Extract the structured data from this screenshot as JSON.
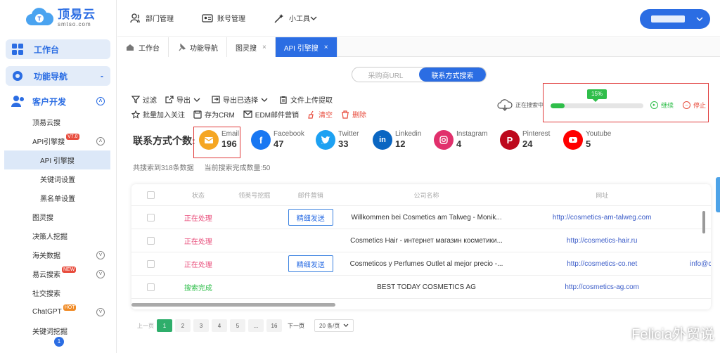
{
  "logo": {
    "title": "顶易云",
    "sub": "smtso.com"
  },
  "sidebar": {
    "workbench": "工作台",
    "function_nav": "功能导航",
    "function_nav_toggle": "-",
    "customer_dev": "客户开发",
    "items": [
      {
        "label": "顶易云搜",
        "badge": ""
      },
      {
        "label": "API引擎搜",
        "badge": "V7.0"
      },
      {
        "label": "API 引擎搜",
        "badge": ""
      },
      {
        "label": "关键词设置",
        "badge": ""
      },
      {
        "label": "黑名单设置",
        "badge": ""
      },
      {
        "label": "图灵搜",
        "badge": ""
      },
      {
        "label": "决策人挖掘",
        "badge": ""
      },
      {
        "label": "海关数据",
        "badge": ""
      },
      {
        "label": "易云搜索",
        "badge": "NEW"
      },
      {
        "label": "社交搜索",
        "badge": ""
      },
      {
        "label": "ChatGPT",
        "badge": "HOT"
      },
      {
        "label": "关键词挖掘",
        "badge": ""
      }
    ],
    "scroll_marker": "1"
  },
  "topbar": {
    "dept": "部门管理",
    "account": "账号管理",
    "tools": "小工具"
  },
  "tabs": [
    {
      "label": "工作台",
      "closable": false
    },
    {
      "label": "功能导航",
      "closable": false
    },
    {
      "label": "图灵搜",
      "closable": true
    },
    {
      "label": "API 引擎搜",
      "closable": true,
      "active": true
    }
  ],
  "toggle": {
    "left": "采购商URL",
    "right": "联系方式搜索"
  },
  "toolbar": {
    "row1": [
      "过滤",
      "导出",
      "导出已选择",
      "文件上传提取"
    ],
    "row2": [
      "批量加入关注",
      "存为CRM",
      "EDM邮件营销",
      "清空",
      "删除"
    ]
  },
  "progress": {
    "status": "正在搜索中",
    "percent_label": "15%",
    "percent": 15,
    "resume": "继续",
    "stop": "停止"
  },
  "contacts": {
    "label": "联系方式个数:",
    "channels": [
      {
        "name": "Email",
        "value": "196",
        "color": "#f5a623"
      },
      {
        "name": "Facebook",
        "value": "47",
        "color": "#1877f2"
      },
      {
        "name": "Twitter",
        "value": "33",
        "color": "#1da1f2"
      },
      {
        "name": "Linkedin",
        "value": "12",
        "color": "#0a66c2"
      },
      {
        "name": "Instagram",
        "value": "4",
        "color": "#e1306c"
      },
      {
        "name": "Pinterest",
        "value": "24",
        "color": "#bd081c"
      },
      {
        "name": "Youtube",
        "value": "5",
        "color": "#ff0000"
      }
    ]
  },
  "summary": {
    "total": "共搜索到318条数据",
    "done": "当前搜索完成数量:50"
  },
  "table": {
    "headers": [
      "状态",
      "领英号挖掘",
      "邮件营销",
      "公司名称",
      "网址"
    ],
    "send_label": "精细发送",
    "rows": [
      {
        "status": "正在处理",
        "state": "proc",
        "send": true,
        "company": "Willkommen bei Cosmetics am Talweg - Monik...",
        "url": "http://cosmetics-am-talweg.com",
        "extra": ""
      },
      {
        "status": "正在处理",
        "state": "proc",
        "send": false,
        "company": "Cosmetics Hair - интернет магазин косметики...",
        "url": "http://cosmetics-hair.ru",
        "extra": ""
      },
      {
        "status": "正在处理",
        "state": "proc",
        "send": true,
        "company": "Cosmeticos y Perfumes Outlet al mejor precio -...",
        "url": "http://cosmetics-co.net",
        "extra": "info@c"
      },
      {
        "status": "搜索完成",
        "state": "done",
        "send": false,
        "company": "BEST TODAY COSMETICS AG",
        "url": "http://cosmetics-ag.com",
        "extra": ""
      }
    ]
  },
  "pager": {
    "prev": "上一页",
    "pages": [
      "1",
      "2",
      "3",
      "4",
      "5",
      "...",
      "16"
    ],
    "next": "下一页",
    "size": "20 条/页"
  },
  "watermark": "Felicia外贸说"
}
